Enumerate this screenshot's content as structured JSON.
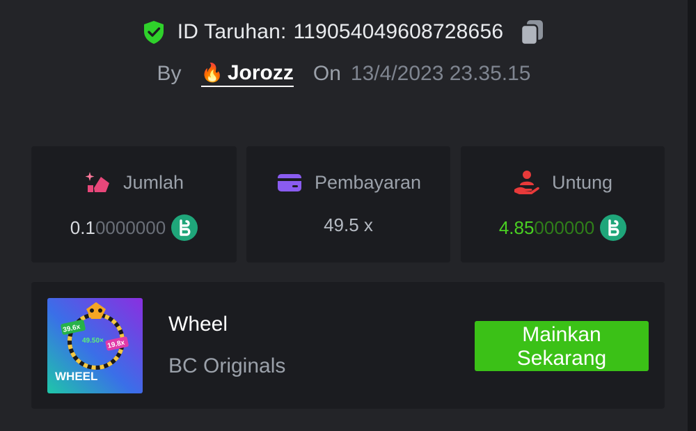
{
  "bet": {
    "label": "ID Taruhan:",
    "id": "119054049608728656"
  },
  "by_line": {
    "by_label": "By",
    "user_emoji": "🔥",
    "username": "Jorozz",
    "on_label": "On",
    "datetime": "13/4/2023 23.35.15"
  },
  "stats": [
    {
      "label": "Jumlah",
      "icon": "bet-amount-icon",
      "value_main": "0.1",
      "value_faded": "0000000",
      "coin": "bc-coin-icon"
    },
    {
      "label": "Pembayaran",
      "icon": "wallet-card-icon",
      "value": "49.5 x"
    },
    {
      "label": "Untung",
      "icon": "profit-hand-icon",
      "value_main": "4.85",
      "value_faded": "000000",
      "coin": "bc-coin-icon"
    }
  ],
  "game": {
    "name": "Wheel",
    "provider": "BC Originals",
    "thumbnail": {
      "title": "WHEEL",
      "chip_left": "39.6x",
      "chip_center": "49.50×",
      "chip_right": "19.8x"
    },
    "play_button": "Mainkan Sekarang"
  },
  "colors": {
    "background": "#232428",
    "card": "#1b1c20",
    "accent_green": "#3bc117",
    "profit_green": "#4ad022",
    "shield_green": "#2fd12b"
  }
}
